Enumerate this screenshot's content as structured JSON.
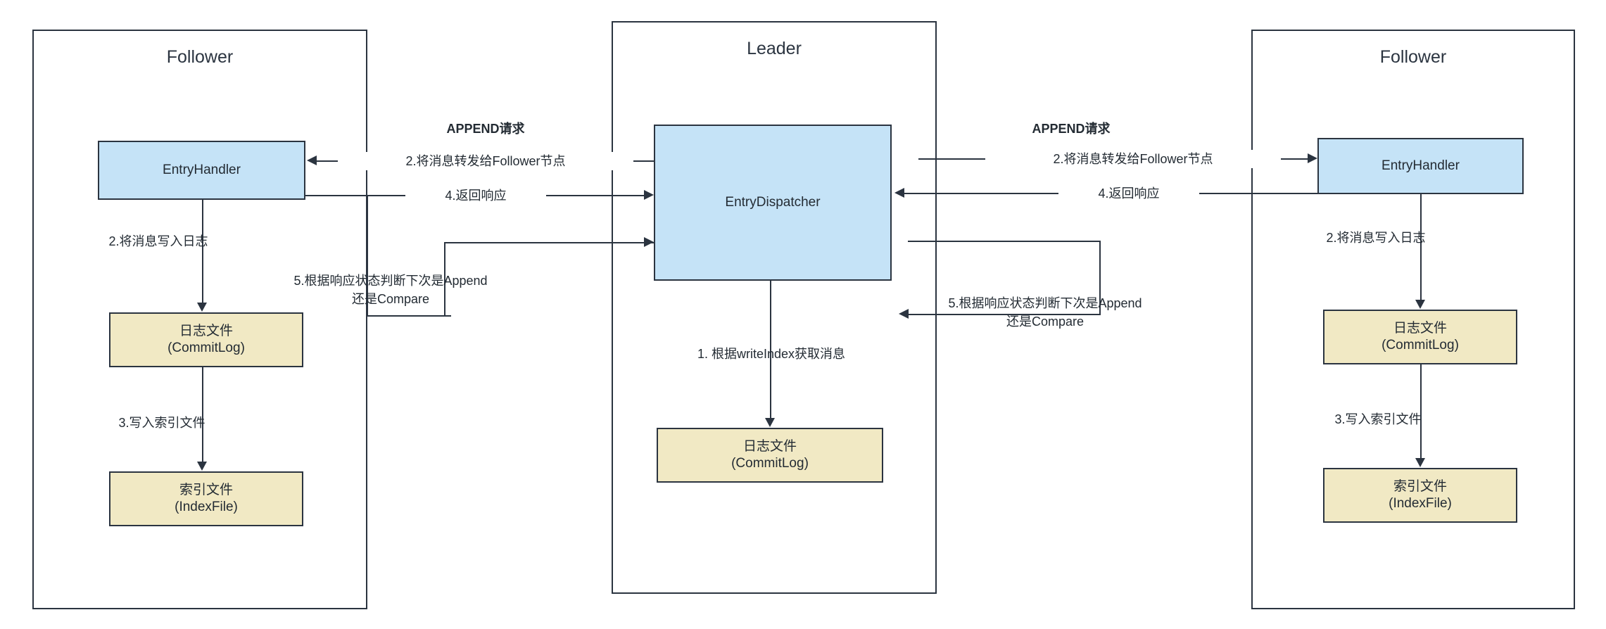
{
  "diagram": {
    "title": "DLedger Append Replication Flow",
    "colors": {
      "stroke": "#2b3440",
      "blue_fill": "#c5e3f7",
      "yellow_fill": "#f1e9c4",
      "background": "#ffffff",
      "text": "#232b33"
    }
  },
  "lanes": [
    {
      "id": "follower-left",
      "title": "Follower"
    },
    {
      "id": "leader",
      "title": "Leader"
    },
    {
      "id": "follower-right",
      "title": "Follower"
    }
  ],
  "nodes": {
    "left_entry_handler": {
      "label": "EntryHandler",
      "type": "blue"
    },
    "left_commitlog": {
      "line1": "日志文件",
      "line2": "(CommitLog)",
      "type": "yellow"
    },
    "left_indexfile": {
      "line1": "索引文件",
      "line2": "(IndexFile)",
      "type": "yellow"
    },
    "center_dispatcher": {
      "label": "EntryDispatcher",
      "type": "blue"
    },
    "center_commitlog": {
      "line1": "日志文件",
      "line2": "(CommitLog)",
      "type": "yellow"
    },
    "right_entry_handler": {
      "label": "EntryHandler",
      "type": "blue"
    },
    "right_commitlog": {
      "line1": "日志文件",
      "line2": "(CommitLog)",
      "type": "yellow"
    },
    "right_indexfile": {
      "line1": "索引文件",
      "line2": "(IndexFile)",
      "type": "yellow"
    }
  },
  "labels": {
    "append_request_left": "APPEND请求",
    "append_request_right": "APPEND请求",
    "forward_left": "2.将消息转发给Follower节点",
    "forward_right": "2.将消息转发给Follower节点",
    "response_left": "4.返回响应",
    "response_right": "4.返回响应",
    "write_log_left": "2.将消息写入日志",
    "write_log_right": "2.将消息写入日志",
    "write_index_left": "3.写入索引文件",
    "write_index_right": "3.写入索引文件",
    "decide_left_line1": "5.根据响应状态判断下次是Append",
    "decide_left_line2": "还是Compare",
    "decide_right_line1": "5.根据响应状态判断下次是Append",
    "decide_right_line2": "还是Compare",
    "fetch_by_writeindex": "1. 根据writeIndex获取消息"
  }
}
